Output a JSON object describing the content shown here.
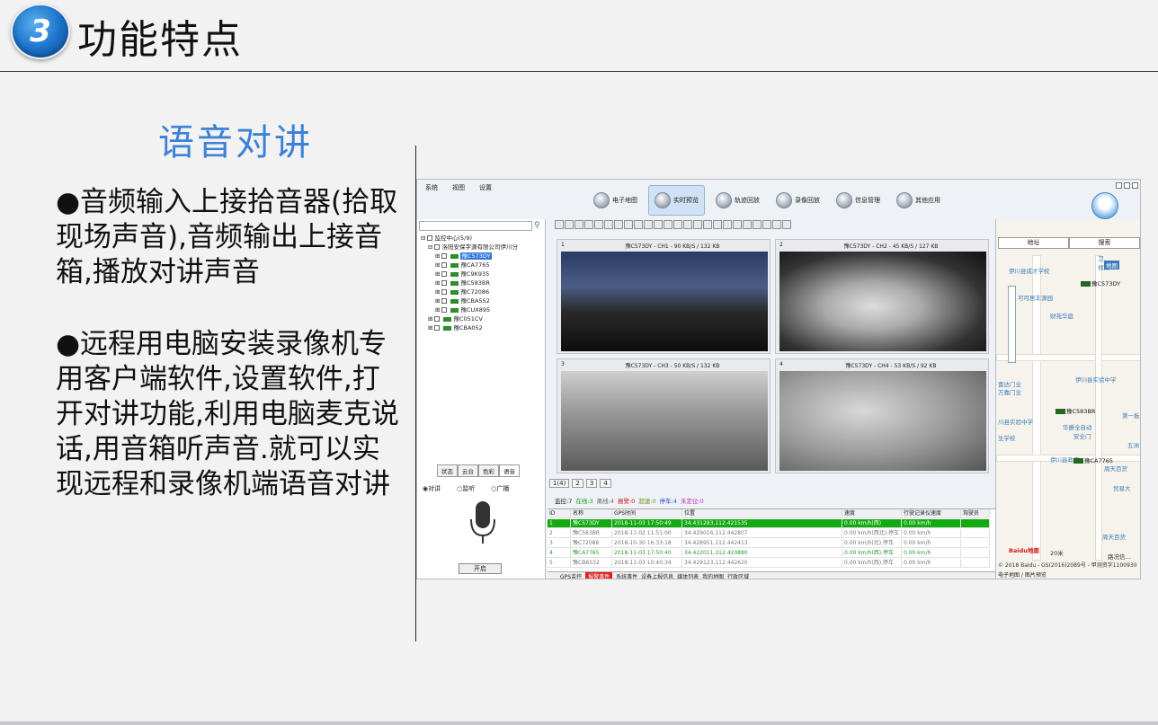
{
  "header": {
    "number": "3",
    "title": "功能特点"
  },
  "section": {
    "title": "语音对讲",
    "para1": "●音频输入上接拾音器(拾取现场声音),音频输出上接音箱,播放对讲声音",
    "para2": "●远程用电脑安装录像机专用客户端软件,设置软件,打开对讲功能,利用电脑麦克说话,用音箱听声音.就可以实现远程和录像机端语音对讲"
  },
  "app": {
    "menu": [
      "系统",
      "视图",
      "设置"
    ],
    "toolbar": [
      "电子地图",
      "实时预览",
      "轨迹回放",
      "录像回放",
      "信息管理",
      "其他应用"
    ],
    "tree": {
      "root": "监控中心(5/9)",
      "company": "洛阳安保字源有限公司伊川分",
      "vehicles": [
        "豫C573DY",
        "豫CA7765",
        "豫C9K935",
        "豫C583BR",
        "豫C72086",
        "豫CBA552",
        "豫CUX895"
      ],
      "others": [
        "豫C051CV",
        "豫CBA052"
      ]
    },
    "left_tabs": [
      "状态",
      "云台",
      "色彩",
      "语音"
    ],
    "radios": [
      "对讲",
      "监听",
      "广播"
    ],
    "open_button": "开启",
    "cells": [
      {
        "n": "1",
        "title": "豫C573DY - CH1 - 90 KB/S / 132 KB"
      },
      {
        "n": "2",
        "title": "豫C573DY - CH2 - 45 KB/S / 127 KB"
      },
      {
        "n": "3",
        "title": "豫C573DY - CH3 - 50 KB/S / 132 KB"
      },
      {
        "n": "4",
        "title": "豫C573DY - CH4 - 53 KB/S / 92 KB"
      }
    ],
    "page_tabs": [
      "1(4)",
      "2",
      "3",
      "4"
    ],
    "stats": {
      "total": "监控:7",
      "online": "在线:3",
      "offline": "离线:4",
      "alarm": "报警:0",
      "speeding": "超速:0",
      "stopped": "停车:4",
      "unlocated": "未定位:0"
    },
    "table": {
      "headers": [
        "ID",
        "名称",
        "GPS时间",
        "位置",
        "速度",
        "行驶记录仪速度",
        "驾驶员"
      ],
      "rows": [
        [
          "1",
          "豫C573DY",
          "2018-11-03 17:50:49",
          "34.431283,112.421535",
          "0.00 km/h(西)",
          "0.00 km/h",
          ""
        ],
        [
          "2",
          "豫C583BR",
          "2018-11-02 11:51:00",
          "34.429016,112.442807",
          "0.00 km/h(西北),停车",
          "0.00 km/h",
          ""
        ],
        [
          "3",
          "豫C72086",
          "2018-10-30 16:33:18",
          "34.428951,112.442413",
          "0.00 km/h(北),停车",
          "0.00 km/h",
          ""
        ],
        [
          "4",
          "豫CA7765",
          "2018-11-03 17:50:40",
          "34.422011,112.420880",
          "0.00 km/h(西),停车",
          "0.00 km/h",
          ""
        ],
        [
          "5",
          "豫CBA552",
          "2018-11-03 10:40:34",
          "34.429123,112.442620",
          "0.00 km/h(西),停车",
          "0.00 km/h",
          ""
        ]
      ]
    },
    "bottom_tabs": [
      "GPS监控",
      "报警事件",
      "系统事件",
      "设备上报信息",
      "媒体列表",
      "我的地图",
      "行政区域"
    ],
    "map": {
      "tabs": [
        "地址",
        "搜索"
      ],
      "pois": [
        "伊川县成才学校",
        "可可居丰源园",
        "财苑华庭",
        "伊川县实验中学",
        "富达门业",
        "万嘉门业",
        "川县实验中学",
        "生学校",
        "华爵全自动",
        "安全门",
        "伊川县政府",
        "周天百货",
        "周天百货",
        "第一板",
        "五洲",
        "贸易大",
        "卫",
        "视频"
      ],
      "vehicles": [
        "豫C573DY",
        "豫C583BR",
        "豫CA7765"
      ],
      "copyright": "© 2018 Baidu - GS(2016)2089号 - 甲测资字1100930",
      "bottom_tabs": [
        "电子地图",
        "图片预览"
      ],
      "map_label": "地图",
      "baidu": "Baidu地图",
      "scale": "20米",
      "roadinfo": "路况信..."
    }
  }
}
